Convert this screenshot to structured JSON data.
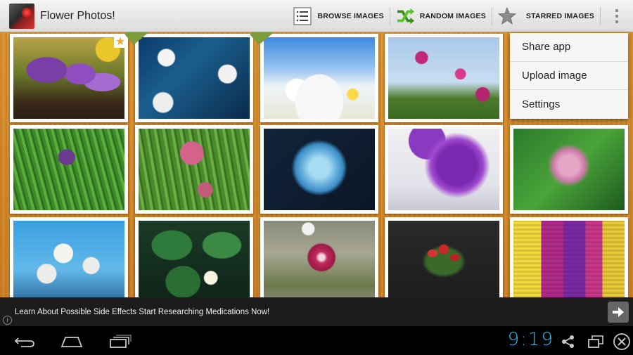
{
  "app": {
    "title": "Flower Photos!"
  },
  "actionbar": {
    "actions": [
      {
        "label": "BROWSE IMAGES",
        "icon": "list-icon"
      },
      {
        "label": "RANDOM IMAGES",
        "icon": "shuffle-icon"
      },
      {
        "label": "STARRED IMAGES",
        "icon": "star-icon"
      }
    ]
  },
  "menu": {
    "items": [
      "Share app",
      "Upload image",
      "Settings"
    ]
  },
  "ad": {
    "text": "Learn About Possible Side Effects Start Researching Medications Now!"
  },
  "status": {
    "time": "9:19"
  },
  "colors": {
    "accent": "#33b5e5",
    "wood": "#d08a2a"
  }
}
